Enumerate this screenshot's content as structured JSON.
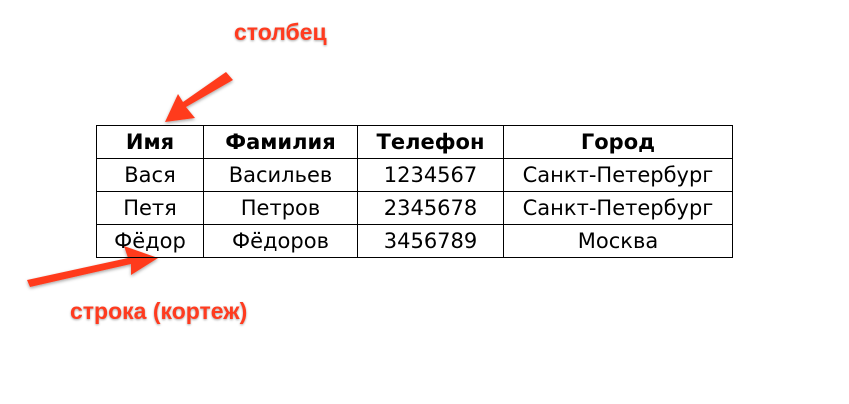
{
  "annotations": {
    "column_label": "столбец",
    "row_label": "строка (кортеж)"
  },
  "table": {
    "headers": [
      "Имя",
      "Фамилия",
      "Телефон",
      "Город"
    ],
    "rows": [
      [
        "Вася",
        "Васильев",
        "1234567",
        "Санкт-Петербург"
      ],
      [
        "Петя",
        "Петров",
        "2345678",
        "Санкт-Петербург"
      ],
      [
        "Фёдор",
        "Фёдоров",
        "3456789",
        "Москва"
      ]
    ]
  },
  "colors": {
    "annotation": "#ff3b1f",
    "table_border": "#000000",
    "text": "#000000",
    "background": "#ffffff"
  }
}
